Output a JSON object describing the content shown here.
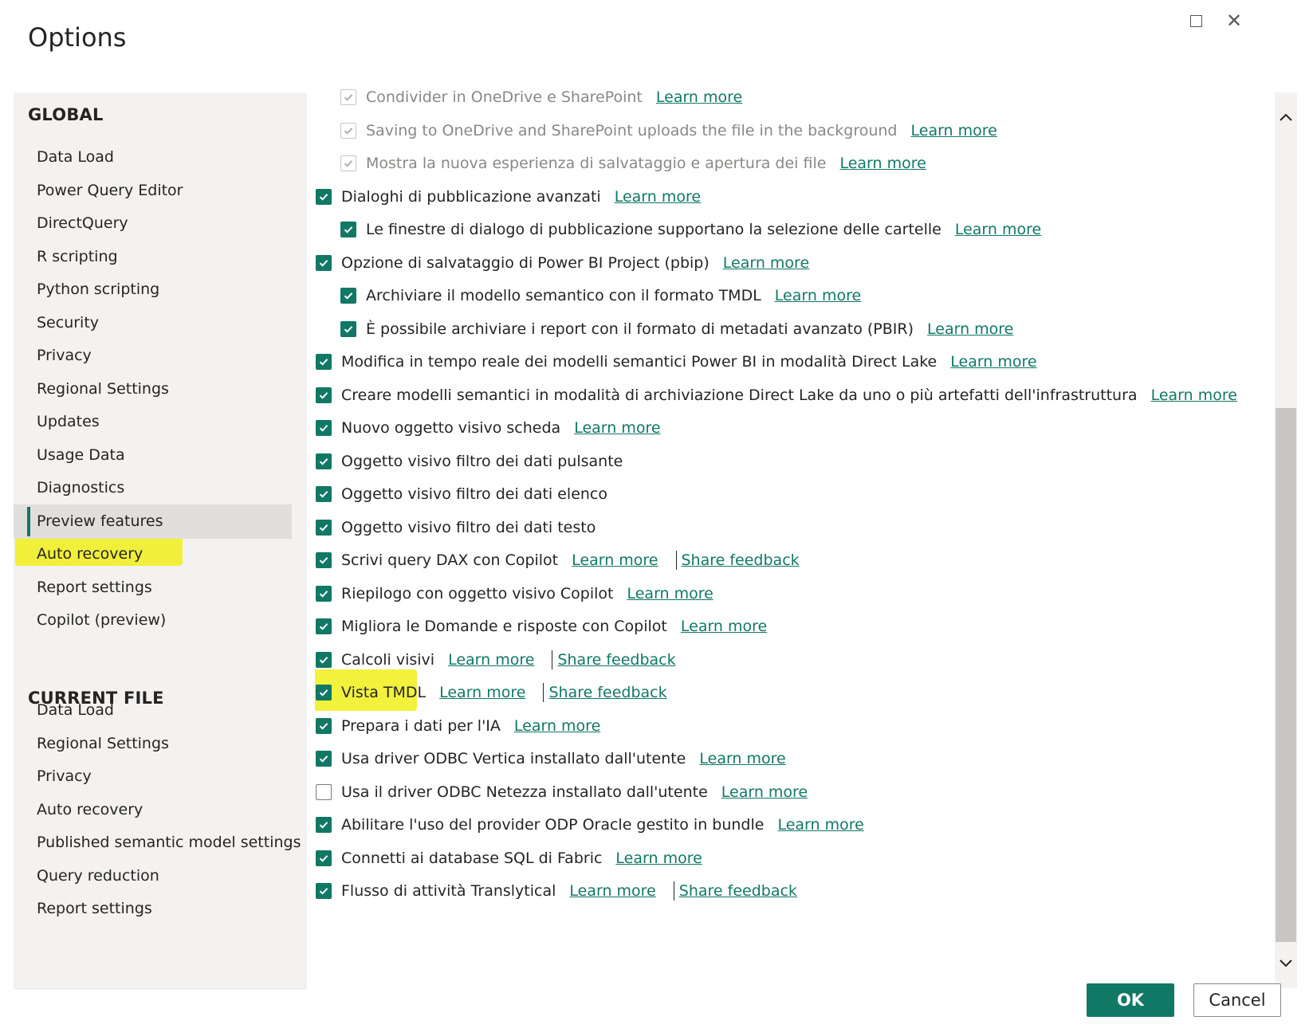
{
  "window": {
    "title": "Options",
    "maximize_icon": "maximize-icon",
    "close_icon": "close-icon",
    "close_glyph": "✕"
  },
  "sidebar": {
    "global_heading": "GLOBAL",
    "global_items": [
      {
        "label": "Data Load"
      },
      {
        "label": "Power Query Editor"
      },
      {
        "label": "DirectQuery"
      },
      {
        "label": "R scripting"
      },
      {
        "label": "Python scripting"
      },
      {
        "label": "Security"
      },
      {
        "label": "Privacy"
      },
      {
        "label": "Regional Settings"
      },
      {
        "label": "Updates"
      },
      {
        "label": "Usage Data"
      },
      {
        "label": "Diagnostics"
      },
      {
        "label": "Preview features",
        "selected": true
      },
      {
        "label": "Auto recovery"
      },
      {
        "label": "Report settings"
      },
      {
        "label": "Copilot (preview)"
      }
    ],
    "current_file_heading": "CURRENT FILE",
    "current_file_items": [
      {
        "label": "Data Load"
      },
      {
        "label": "Regional Settings"
      },
      {
        "label": "Privacy"
      },
      {
        "label": "Auto recovery"
      },
      {
        "label": "Published semantic model settings"
      },
      {
        "label": "Query reduction"
      },
      {
        "label": "Report settings"
      }
    ]
  },
  "options": [
    {
      "label": "Condivider in OneDrive e SharePoint",
      "checked": true,
      "disabled": true,
      "indent": 1,
      "link": "Learn more"
    },
    {
      "label": "Saving to OneDrive and SharePoint uploads the file in the background",
      "checked": true,
      "disabled": true,
      "indent": 1,
      "link": "Learn more"
    },
    {
      "label": "Mostra la nuova esperienza di salvataggio e apertura dei file",
      "checked": true,
      "disabled": true,
      "indent": 1,
      "link": "Learn more"
    },
    {
      "label": "Dialoghi di pubblicazione avanzati",
      "checked": true,
      "indent": 0,
      "link": "Learn more"
    },
    {
      "label": "Le finestre di dialogo di pubblicazione supportano la selezione delle cartelle",
      "checked": true,
      "indent": 1,
      "link": "Learn more"
    },
    {
      "label": "Opzione di salvataggio di Power BI Project (pbip)",
      "checked": true,
      "indent": 0,
      "link": "Learn more"
    },
    {
      "label": "Archiviare il modello semantico con il formato TMDL",
      "checked": true,
      "indent": 1,
      "link": "Learn more"
    },
    {
      "label": "È possibile archiviare i report con il formato di metadati avanzato (PBIR)",
      "checked": true,
      "indent": 1,
      "link": "Learn more"
    },
    {
      "label": "Modifica in tempo reale dei modelli semantici Power BI in modalità Direct Lake",
      "checked": true,
      "indent": 0,
      "link": "Learn more"
    },
    {
      "label": "Creare modelli semantici in modalità di archiviazione Direct Lake da uno o più artefatti dell'infrastruttura",
      "checked": true,
      "indent": 0,
      "link": "Learn more"
    },
    {
      "label": "Nuovo oggetto visivo scheda",
      "checked": true,
      "indent": 0,
      "link": "Learn more"
    },
    {
      "label": "Oggetto visivo filtro dei dati pulsante",
      "checked": true,
      "indent": 0
    },
    {
      "label": "Oggetto visivo filtro dei dati elenco",
      "checked": true,
      "indent": 0
    },
    {
      "label": "Oggetto visivo filtro dei dati testo",
      "checked": true,
      "indent": 0
    },
    {
      "label": "Scrivi query DAX con Copilot",
      "checked": true,
      "indent": 0,
      "link": "Learn more",
      "feedback": "Share feedback"
    },
    {
      "label": "Riepilogo con oggetto visivo Copilot",
      "checked": true,
      "indent": 0,
      "link": "Learn more"
    },
    {
      "label": "Migliora le Domande e risposte con Copilot",
      "checked": true,
      "indent": 0,
      "link": "Learn more"
    },
    {
      "label": "Calcoli visivi",
      "checked": true,
      "indent": 0,
      "link": "Learn more",
      "feedback": "Share feedback"
    },
    {
      "label": "Vista TMDL",
      "checked": true,
      "indent": 0,
      "link": "Learn more",
      "feedback": "Share feedback"
    },
    {
      "label": "Prepara i dati per l'IA",
      "checked": true,
      "indent": 0,
      "link": "Learn more"
    },
    {
      "label": "Usa driver ODBC Vertica installato dall'utente",
      "checked": true,
      "indent": 0,
      "link": "Learn more"
    },
    {
      "label": "Usa il driver ODBC Netezza installato dall'utente",
      "checked": false,
      "indent": 0,
      "link": "Learn more"
    },
    {
      "label": "Abilitare l'uso del provider ODP Oracle gestito in bundle",
      "checked": true,
      "indent": 0,
      "link": "Learn more"
    },
    {
      "label": "Connetti ai database SQL di Fabric",
      "checked": true,
      "indent": 0,
      "link": "Learn more"
    },
    {
      "label": "Flusso di attività Translytical",
      "checked": true,
      "indent": 0,
      "link": "Learn more",
      "feedback": "Share feedback"
    }
  ],
  "scrollbar": {
    "up_icon": "chevron-up-icon",
    "down_icon": "chevron-down-icon"
  },
  "footer": {
    "ok_label": "OK",
    "cancel_label": "Cancel"
  },
  "colors": {
    "accent": "#117865",
    "highlight": "#f0ef1a",
    "sidebar_bg": "#f3f2f1"
  }
}
